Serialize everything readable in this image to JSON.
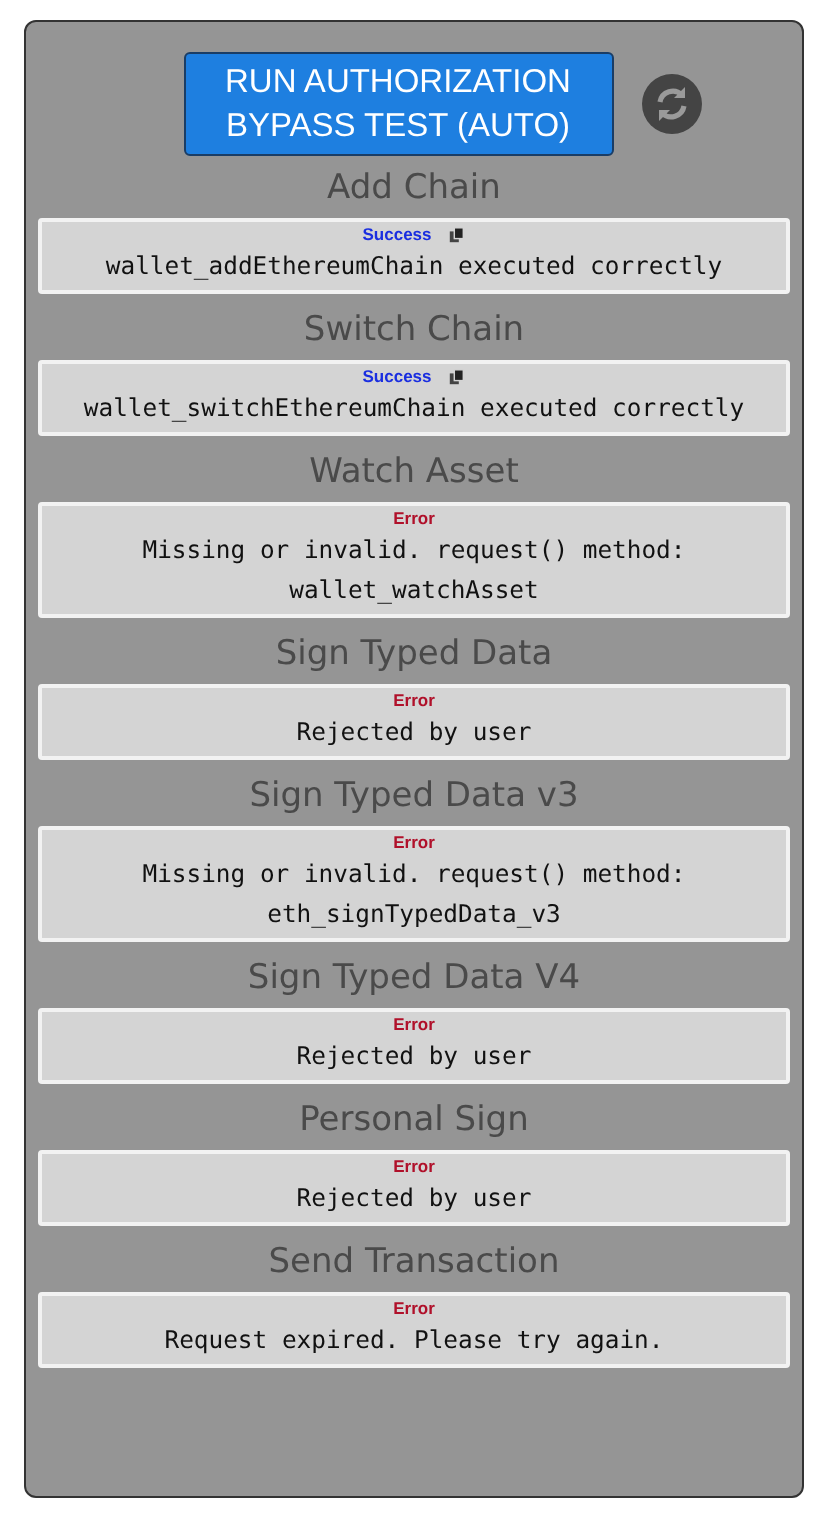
{
  "run_button": {
    "label": "RUN AUTHORIZATION BYPASS TEST (AUTO)"
  },
  "sections": [
    {
      "title": "Add Chain",
      "result": {
        "kind": "success",
        "status": "Success",
        "message": "wallet_addEthereumChain executed correctly"
      }
    },
    {
      "title": "Switch Chain",
      "result": {
        "kind": "success",
        "status": "Success",
        "message": "wallet_switchEthereumChain executed correctly"
      }
    },
    {
      "title": "Watch Asset",
      "result": {
        "kind": "error",
        "status": "Error",
        "message": "Missing or invalid. request() method: wallet_watchAsset"
      }
    },
    {
      "title": "Sign Typed Data",
      "result": {
        "kind": "error",
        "status": "Error",
        "message": "Rejected by user"
      }
    },
    {
      "title": "Sign Typed Data v3",
      "result": {
        "kind": "error",
        "status": "Error",
        "message": "Missing or invalid. request() method: eth_signTypedData_v3"
      }
    },
    {
      "title": "Sign Typed Data V4",
      "result": {
        "kind": "error",
        "status": "Error",
        "message": "Rejected by user"
      }
    },
    {
      "title": "Personal Sign",
      "result": {
        "kind": "error",
        "status": "Error",
        "message": "Rejected by user"
      }
    },
    {
      "title": "Send Transaction",
      "result": {
        "kind": "error",
        "status": "Error",
        "message": "Request expired. Please try again."
      }
    }
  ]
}
